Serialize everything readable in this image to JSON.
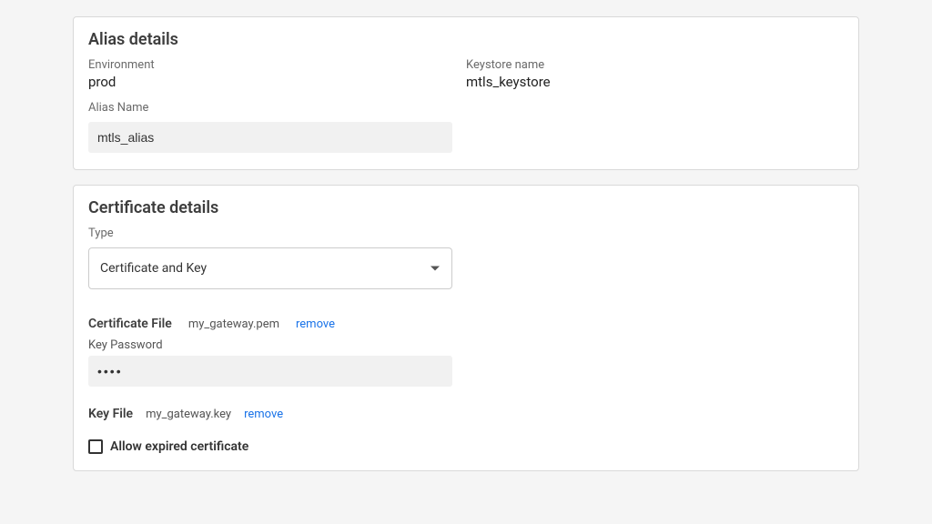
{
  "alias_details": {
    "title": "Alias details",
    "environment_label": "Environment",
    "environment_value": "prod",
    "keystore_label": "Keystore name",
    "keystore_value": "mtls_keystore",
    "alias_name_label": "Alias Name",
    "alias_name_value": "mtls_alias"
  },
  "certificate_details": {
    "title": "Certificate details",
    "type_label": "Type",
    "type_value": "Certificate and Key",
    "certificate_file_label": "Certificate File",
    "certificate_file_name": "my_gateway.pem",
    "certificate_file_remove": "remove",
    "key_password_label": "Key Password",
    "key_password_value": "••••",
    "key_file_label": "Key File",
    "key_file_name": "my_gateway.key",
    "key_file_remove": "remove",
    "allow_expired_label": "Allow expired certificate",
    "allow_expired_checked": false
  }
}
